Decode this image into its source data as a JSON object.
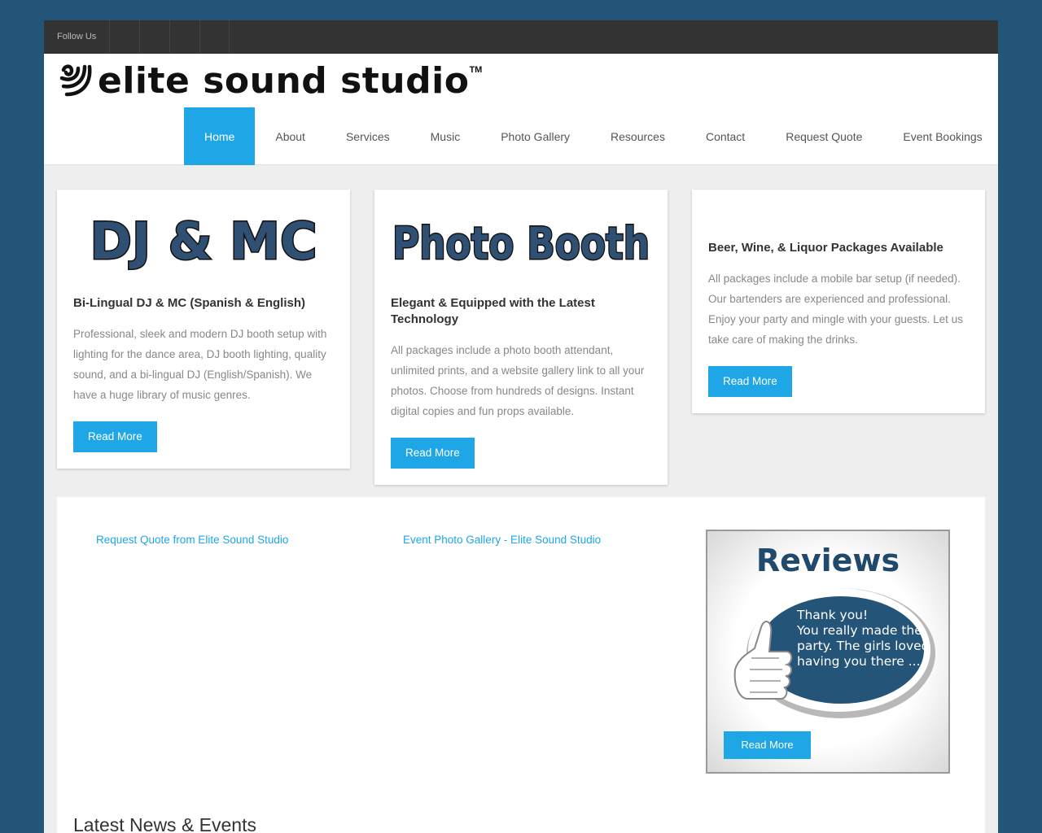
{
  "topbar": {
    "follow_label": "Follow Us",
    "social_icons": [
      "facebook-icon",
      "twitter-icon",
      "youtube-icon",
      "instagram-icon"
    ]
  },
  "brand": {
    "name": "elite sound studio",
    "tm": "TM"
  },
  "nav": {
    "items": [
      {
        "label": "Home",
        "active": true
      },
      {
        "label": "About"
      },
      {
        "label": "Services"
      },
      {
        "label": "Music"
      },
      {
        "label": "Photo Gallery"
      },
      {
        "label": "Resources"
      },
      {
        "label": "Contact"
      },
      {
        "label": "Request Quote"
      },
      {
        "label": "Event Bookings"
      }
    ]
  },
  "cards": [
    {
      "graphic_text": "DJ & MC",
      "title": "Bi-Lingual DJ & MC (Spanish & English)",
      "body": "Professional, sleek and modern DJ booth setup with lighting for the dance area, DJ booth lighting, quality sound, and a bi-lingual DJ (English/Spanish). We have a huge library of music genres.",
      "button": "Read More"
    },
    {
      "graphic_text": "Photo Booth",
      "title": "Elegant & Equipped with the Latest Technology",
      "body": "All packages include a photo booth attendant, unlimited prints, and a website gallery link to all your photos. Choose from hundreds of designs. Instant digital copies and fun props available.",
      "button": "Read More"
    },
    {
      "title": "Beer, Wine, & Liquor Packages Available",
      "body": "All packages include a mobile bar setup (if needed). Our bartenders are experienced and professional. Enjoy your party and mingle with your guests. Let us take care of making the drinks.",
      "button": "Read More"
    }
  ],
  "links": {
    "quote": "Request Quote from Elite Sound Studio",
    "gallery": "Event Photo Gallery - Elite Sound Studio"
  },
  "reviews": {
    "title": "Reviews",
    "quote_line1": "Thank you!",
    "quote_line2": "You really made the party.  The girls loved having you there ....",
    "button": "Read More"
  },
  "news": {
    "heading": "Latest News & Events"
  },
  "colors": {
    "accent": "#1ea6e6",
    "background": "#235579",
    "topbar": "#333333",
    "graphic_fill": "#2f4f73"
  }
}
